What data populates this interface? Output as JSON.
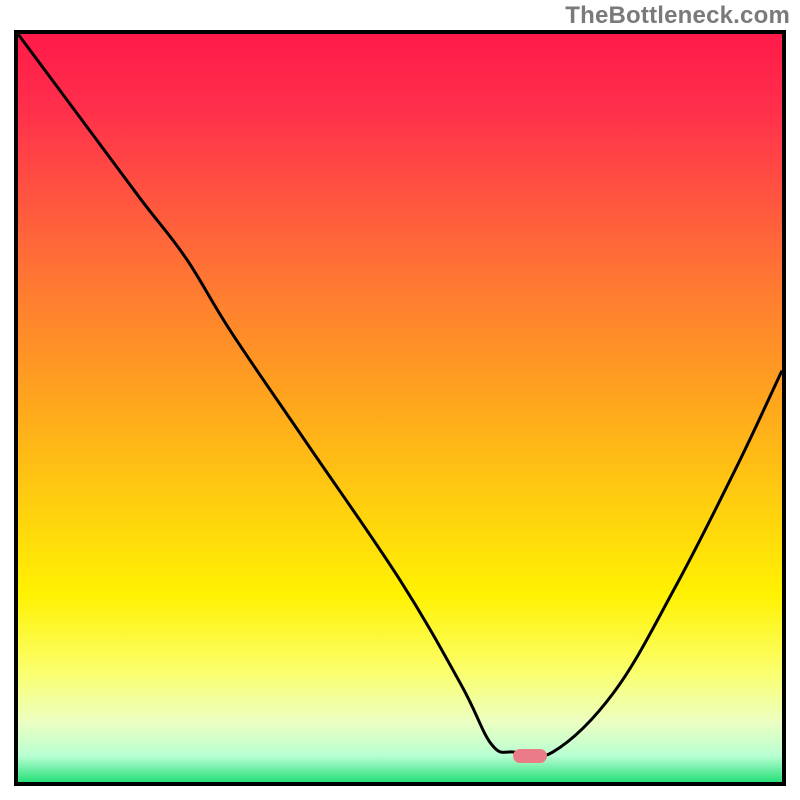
{
  "watermark": "TheBottleneck.com",
  "colors": {
    "border": "#000000",
    "marker": "#eb7b87",
    "curve": "#000000"
  },
  "gradient_stops": [
    {
      "offset": 0.0,
      "color": "#ff1a4a"
    },
    {
      "offset": 0.1,
      "color": "#ff2f4b"
    },
    {
      "offset": 0.22,
      "color": "#ff5540"
    },
    {
      "offset": 0.35,
      "color": "#ff7d30"
    },
    {
      "offset": 0.5,
      "color": "#ffa81c"
    },
    {
      "offset": 0.63,
      "color": "#ffcf0f"
    },
    {
      "offset": 0.75,
      "color": "#fff202"
    },
    {
      "offset": 0.85,
      "color": "#fbff6a"
    },
    {
      "offset": 0.92,
      "color": "#ecffc2"
    },
    {
      "offset": 0.965,
      "color": "#b8ffd2"
    },
    {
      "offset": 1.0,
      "color": "#27e07a"
    }
  ],
  "chart_data": {
    "type": "line",
    "title": "",
    "xlabel": "",
    "ylabel": "",
    "xlim": [
      0,
      100
    ],
    "ylim": [
      0,
      100
    ],
    "grid": false,
    "series": [
      {
        "name": "bottleneck-curve",
        "x": [
          0,
          8,
          16,
          22,
          28,
          38,
          50,
          58,
          62,
          65,
          70,
          78,
          86,
          94,
          100
        ],
        "y": [
          100,
          89,
          78,
          70,
          60,
          45,
          27,
          13,
          5,
          4,
          4,
          12,
          26,
          42,
          55
        ]
      }
    ],
    "annotations": [
      {
        "name": "optimal-marker",
        "x": 67,
        "y": 3.5,
        "shape": "pill",
        "color": "#eb7b87"
      }
    ]
  }
}
